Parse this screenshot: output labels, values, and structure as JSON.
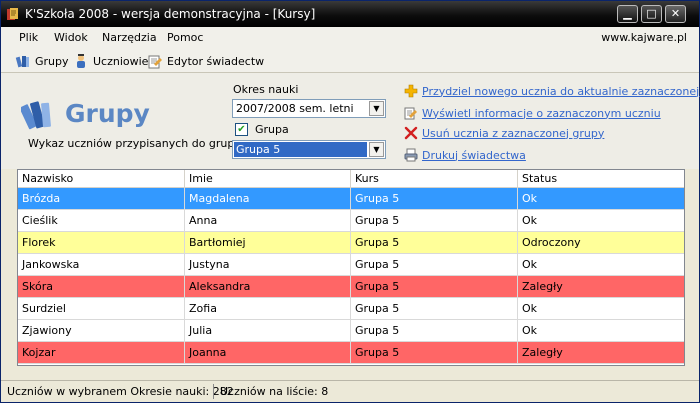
{
  "window": {
    "title": "K'Szkoła 2008 - wersja demonstracyjna - [Kursy]"
  },
  "window_controls": {
    "minimize": "▁",
    "maximize": "□",
    "close": "✕"
  },
  "menu": {
    "items": [
      "Plik",
      "Widok",
      "Narzędzia",
      "Pomoc"
    ],
    "website": "www.kajware.pl"
  },
  "toolbar": {
    "groups_label": "Grupy",
    "students_label": "Uczniowie",
    "certificate_editor_label": "Edytor świadectw"
  },
  "header": {
    "title": "Grupy",
    "subtitle": "Wykaz uczniów przypisanych do grup",
    "period_label": "Okres nauki",
    "period_value": "2007/2008 sem. letni",
    "group_checkbox_label": "Grupa",
    "group_checked": true,
    "group_value": "Grupa 5"
  },
  "actions": [
    {
      "label": "Przydziel nowego ucznia do aktualnie zaznaczonej grupy",
      "icon": "plus-icon"
    },
    {
      "label": "Wyświetl informacje o zaznaczonym uczniu",
      "icon": "info-icon"
    },
    {
      "label": "Usuń ucznia z zaznaczonej grupy",
      "icon": "remove-icon"
    },
    {
      "label": "Drukuj świadectwa",
      "icon": "print-icon"
    }
  ],
  "table": {
    "columns": [
      "Nazwisko",
      "Imie",
      "Kurs",
      "Status"
    ],
    "rows": [
      {
        "cells": [
          "Brózda",
          "Magdalena",
          "Grupa 5",
          "Ok"
        ],
        "state": "selected"
      },
      {
        "cells": [
          "Cieślik",
          "Anna",
          "Grupa 5",
          "Ok"
        ],
        "state": "normal"
      },
      {
        "cells": [
          "Florek",
          "Bartłomiej",
          "Grupa 5",
          "Odroczony"
        ],
        "state": "deferred"
      },
      {
        "cells": [
          "Jankowska",
          "Justyna",
          "Grupa 5",
          "Ok"
        ],
        "state": "normal"
      },
      {
        "cells": [
          "Skóra",
          "Aleksandra",
          "Grupa 5",
          "Zaległy"
        ],
        "state": "overdue"
      },
      {
        "cells": [
          "Surdziel",
          "Zofia",
          "Grupa 5",
          "Ok"
        ],
        "state": "normal"
      },
      {
        "cells": [
          "Zjawiony",
          "Julia",
          "Grupa 5",
          "Ok"
        ],
        "state": "normal"
      },
      {
        "cells": [
          "Kojzar",
          "Joanna",
          "Grupa 5",
          "Zaległy"
        ],
        "state": "overdue"
      }
    ]
  },
  "row_colors": {
    "selected": {
      "bg": "#3399ff",
      "fg": "#ffffff"
    },
    "deferred": {
      "bg": "#ffff99",
      "fg": "#000000"
    },
    "overdue": {
      "bg": "#ff6666",
      "fg": "#000000"
    },
    "normal": {
      "bg": "#ffffff",
      "fg": "#000000"
    }
  },
  "status": {
    "period_count_text": "Uczniów w wybranem Okresie nauki: 282",
    "list_count_text": "Uczniów na liście: 8"
  }
}
